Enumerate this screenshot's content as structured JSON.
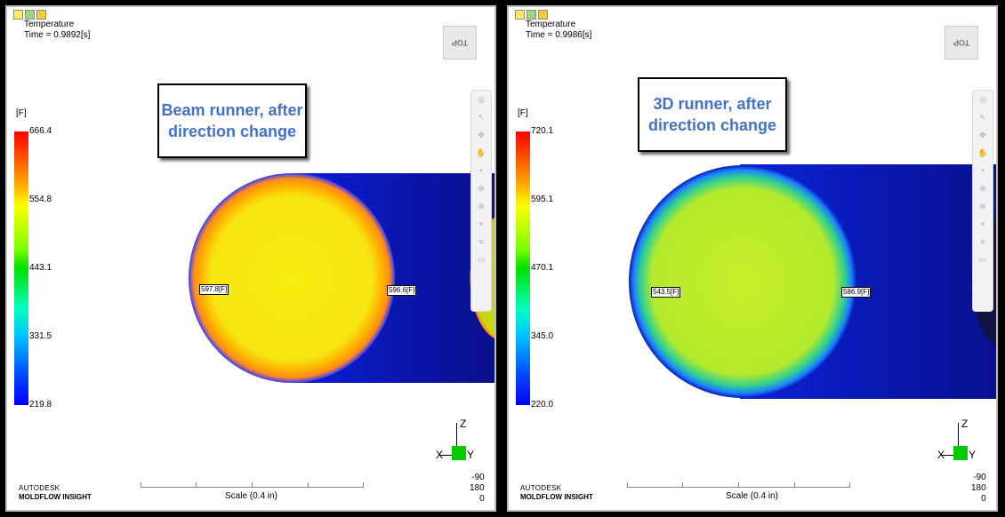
{
  "panels": [
    {
      "header": {
        "result": "Temperature",
        "time": "Time = 0.9892[s]"
      },
      "view_cube": "TOP",
      "legend": {
        "unit": "[F]",
        "ticks": [
          "666.4",
          "554.8",
          "443.1",
          "331.5",
          "219.8"
        ]
      },
      "callout": "Beam runner, after direction change",
      "probes": [
        "597.8[F]",
        "596.6[F]"
      ],
      "triad": {
        "z": "Z",
        "x": "X",
        "y": "Y"
      },
      "scale": "Scale (0.4 in)",
      "brand": {
        "company": "AUTODESK",
        "product": "MOLDFLOW INSIGHT"
      },
      "angles": [
        "-90",
        "180",
        "0"
      ]
    },
    {
      "header": {
        "result": "Temperature",
        "time": "Time = 0.9986[s]"
      },
      "view_cube": "TOP",
      "legend": {
        "unit": "[F]",
        "ticks": [
          "720.1",
          "595.1",
          "470.1",
          "345.0",
          "220.0"
        ]
      },
      "callout": "3D runner, after direction change",
      "probes": [
        "543.5[F]",
        "586.9[F]"
      ],
      "triad": {
        "z": "Z",
        "x": "X",
        "y": "Y"
      },
      "scale": "Scale (0.4 in)",
      "brand": {
        "company": "AUTODESK",
        "product": "MOLDFLOW INSIGHT"
      },
      "angles": [
        "-90",
        "180",
        "0"
      ]
    }
  ],
  "colors": {
    "accent_text": "#4472c4",
    "cold": "#0000ff",
    "hot": "#ff0000"
  }
}
